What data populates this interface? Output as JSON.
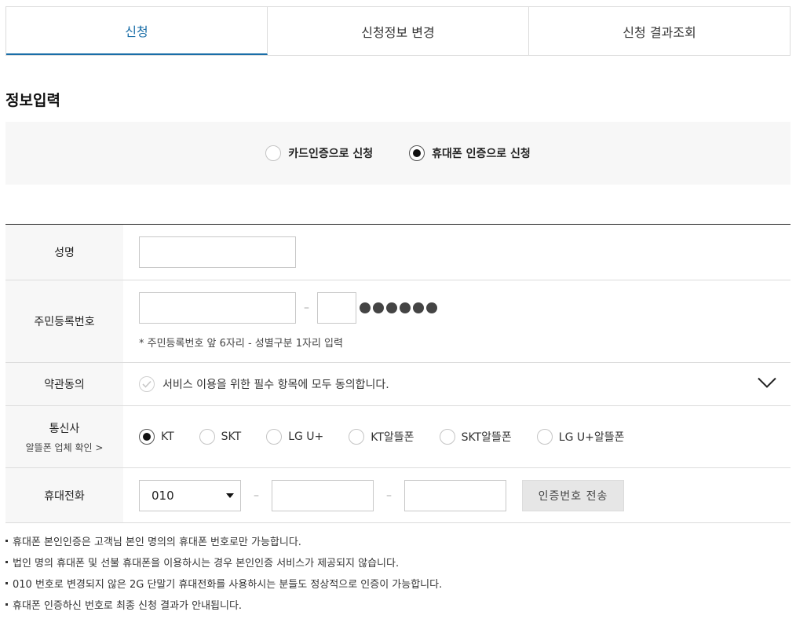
{
  "tabs": [
    {
      "label": "신청"
    },
    {
      "label": "신청정보 변경"
    },
    {
      "label": "신청 결과조회"
    }
  ],
  "section_title": "정보입력",
  "auth_methods": {
    "card": "카드인증으로 신청",
    "phone": "휴대폰 인증으로 신청"
  },
  "form": {
    "name_label": "성명",
    "rrn_label": "주민등록번호",
    "rrn_dash": "–",
    "rrn_hint": "* 주민등록번호 앞 6자리 - 성별구분 1자리 입력",
    "terms_label": "약관동의",
    "terms_text": "서비스 이용을 위한 필수 항목에 모두 동의합니다.",
    "carrier_label": "통신사",
    "carrier_sub": "알뜰폰 업체 확인 >",
    "carriers": [
      "KT",
      "SKT",
      "LG U+",
      "KT알뜰폰",
      "SKT알뜰폰",
      "LG U+알뜰폰"
    ],
    "selected_carrier": "KT",
    "phone_label": "휴대전화",
    "phone_prefix": "010",
    "phone_dash": "–",
    "send_button": "인증번호 전송"
  },
  "notes": [
    "휴대폰 본인인증은 고객님 본인 명의의 휴대폰 번호로만 가능합니다.",
    "법인 명의 휴대폰 및 선불 휴대폰을 이용하시는 경우 본인인증 서비스가 제공되지 않습니다.",
    "010 번호로 변경되지 않은 2G 단말기 휴대전화를 사용하시는 분들도 정상적으로 인증이 가능합니다.",
    "휴대폰 인증하신 번호로 최종 신청 결과가 안내됩니다."
  ],
  "colors": {
    "accent": "#1a6ea8"
  }
}
